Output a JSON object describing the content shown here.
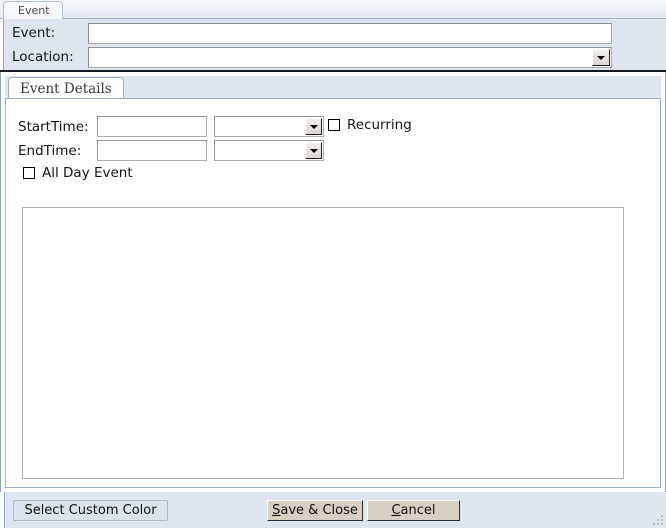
{
  "window": {
    "title": "Event"
  },
  "header": {
    "fields": [
      {
        "label": "Event:",
        "value": "",
        "placeholder": "",
        "type": "text"
      },
      {
        "label": "Location:",
        "value": "",
        "placeholder": "",
        "type": "combobox"
      }
    ]
  },
  "tabs": [
    {
      "label": "Event Details",
      "selected": true
    }
  ],
  "event_details": {
    "rows": [
      {
        "label": "StartTime:",
        "time_value": "",
        "period_value": ""
      },
      {
        "label": "EndTime:",
        "time_value": "",
        "period_value": ""
      }
    ],
    "checkboxes": [
      {
        "label": "Recurring",
        "checked": false
      },
      {
        "label": "All Day Event",
        "checked": false
      }
    ],
    "notes": {
      "value": "",
      "placeholder": ""
    }
  },
  "footer": {
    "buttons": [
      {
        "label": "Select Custom Color",
        "accel": "",
        "style": "light"
      },
      {
        "label": "Save & Close",
        "accel": "S",
        "style": "classic"
      },
      {
        "label": "Cancel",
        "accel": "C",
        "style": "classic"
      }
    ]
  },
  "icons": {
    "dropdown": "chevron-down-icon",
    "resize": "resize-grip-icon"
  },
  "colors": {
    "panel_bg": "#dfe5ee",
    "page_bg": "#ffffff",
    "border_blue": "#9db2c8",
    "classic_button": "#d6cfc2",
    "light_button": "#dce3ee",
    "rule": "#15181c"
  }
}
